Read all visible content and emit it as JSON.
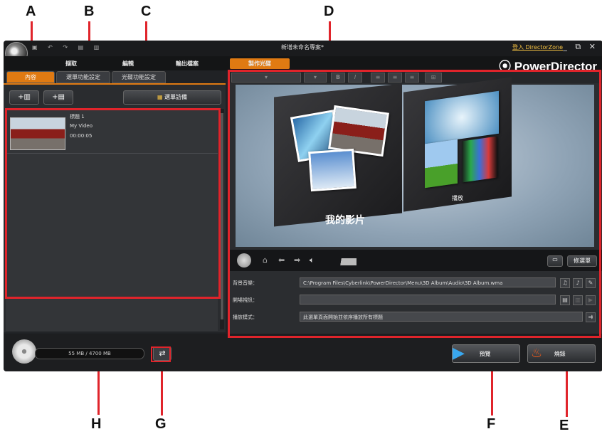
{
  "callouts": {
    "A": "A",
    "B": "B",
    "C": "C",
    "D": "D",
    "E": "E",
    "F": "F",
    "G": "G",
    "H": "H"
  },
  "window": {
    "title": "新增未命名專案*",
    "dz_link": "登入 DirectorZone",
    "controls": "_ ⧉ ✕",
    "icons": "▣ ↶ ↷ ▤ ▥"
  },
  "brand": {
    "text": "PowerDirector"
  },
  "main_tabs": [
    {
      "label": "擷取"
    },
    {
      "label": "編輯"
    },
    {
      "label": "輸出檔案"
    },
    {
      "label": "製作光碟"
    }
  ],
  "sub_tabs": [
    {
      "label": "內容"
    },
    {
      "label": "選單功能設定"
    },
    {
      "label": "光碟功能設定"
    }
  ],
  "left": {
    "add_title": "+▥",
    "add_chapter": "+▤",
    "menu_pref": "選單訪備"
  },
  "item": {
    "name": "標題 1",
    "type": "My Video",
    "duration": "00:00:05"
  },
  "toolbar": {
    "bold": "B",
    "italic": "I"
  },
  "preview": {
    "menu_title": "我的影片",
    "play_label": "播放"
  },
  "controls": {
    "modify_menu": "修選單"
  },
  "fields": {
    "bg_music_label": "背景音樂：",
    "bg_music_value": "C:\\Program Files\\Cyberlink\\PowerDirector\\Menu\\3D Album\\Audio\\3D Album.wma",
    "intro_label": "開場視訊：",
    "intro_value": "",
    "playback_label": "播放模式：",
    "playback_value": "此選單頁面開始並依序播放所有標題"
  },
  "bottom": {
    "capacity": "55 MB / 4700 MB",
    "preview_btn": "預覽",
    "burn_btn": "燒錄"
  }
}
